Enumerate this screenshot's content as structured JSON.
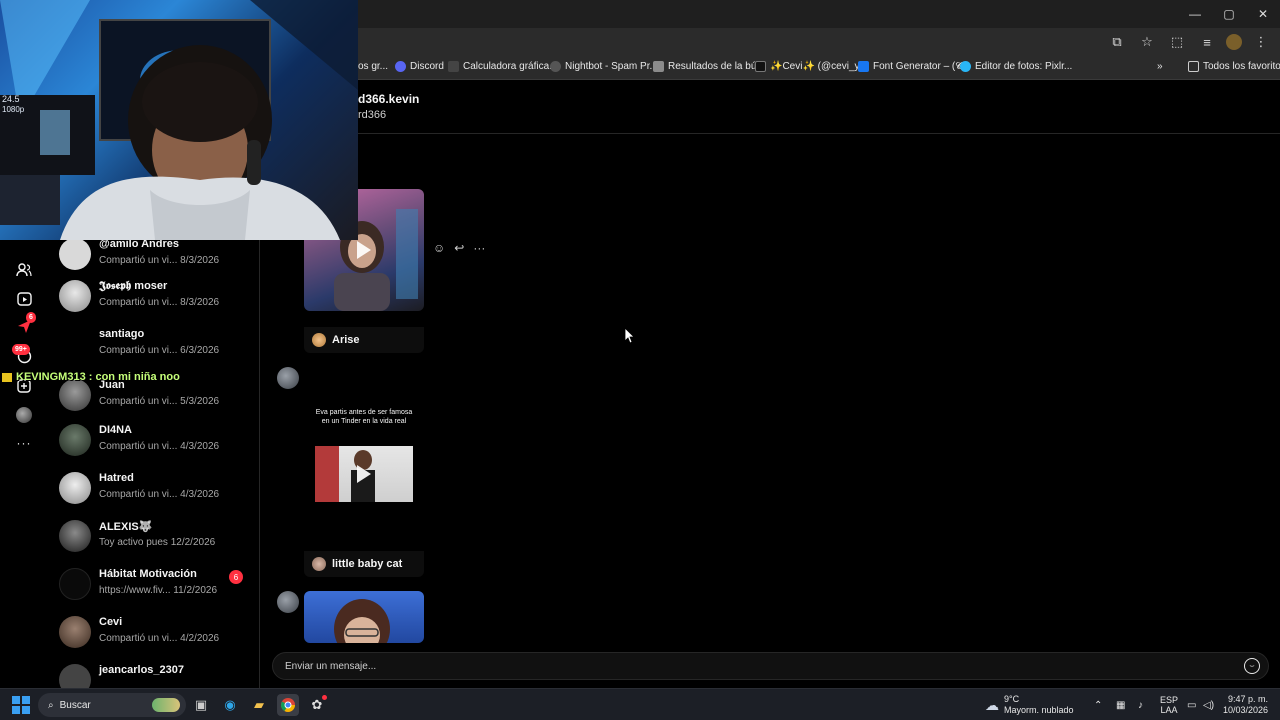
{
  "browser": {
    "window_controls": [
      "—",
      "▢",
      "✕"
    ],
    "toolbar_icons": [
      "cast-icon",
      "star-icon",
      "extensions-icon",
      "media-icon",
      "profile-icon",
      "menu-icon"
    ],
    "bookmarks": [
      {
        "label": "os gr...",
        "icon": "bookmark-icon",
        "color": "#3b3b3b"
      },
      {
        "label": "Discord",
        "icon": "discord-icon",
        "color": "#5865f2"
      },
      {
        "label": "Calculadora gráfica...",
        "icon": "desmos-icon",
        "color": "#444"
      },
      {
        "label": "Nightbot - Spam Pr...",
        "icon": "nightbot-icon",
        "color": "#444"
      },
      {
        "label": "Resultados de la bú...",
        "icon": "doc-icon",
        "color": "#8b8b8b"
      },
      {
        "label": "✨Cevi✨ (@cevi_y...",
        "icon": "tiktok-icon",
        "color": "#111"
      },
      {
        "label": "Font Generator – (𝓒...",
        "icon": "font-icon",
        "color": "#1877f2"
      },
      {
        "label": "Editor de fotos: Pixlr...",
        "icon": "pixlr-icon",
        "color": "#29b6f6"
      }
    ],
    "bookmarks_overflow": "»",
    "all_bookmarks": "Todos los favoritos"
  },
  "stream_overlay": {
    "chat_line": "KEVINGM313 : con mi niña noo"
  },
  "rail": {
    "badges": {
      "notifications": "6",
      "messages": "99+"
    }
  },
  "conversations": [
    {
      "name": "@amilo Andres",
      "preview": "Compartió un vi...",
      "date": "8/3/2026",
      "avatar_color": "#d9d9d9"
    },
    {
      "name": "𝕵𝖔𝖘𝖊𝖕𝖍 moser",
      "preview": "Compartió un vi...",
      "date": "8/3/2026",
      "avatar_color": "#cfcfcf"
    },
    {
      "name": "santiago",
      "preview": "Compartió un vi...",
      "date": "6/3/2026",
      "avatar_color": "#000000"
    },
    {
      "name": "Juan",
      "preview": "Compartió un vi...",
      "date": "5/3/2026",
      "avatar_color": "#6b6b6b"
    },
    {
      "name": "DI4NA",
      "preview": "Compartió un vi...",
      "date": "4/3/2026",
      "avatar_color": "#3a4a3a"
    },
    {
      "name": "Hatred",
      "preview": "Compartió un vi...",
      "date": "4/3/2026",
      "avatar_color": "#bdbdbd"
    },
    {
      "name": "ALEXIS🐺",
      "preview": "Toy activo pues",
      "date": "12/2/2026",
      "avatar_color": "#555"
    },
    {
      "name": "Hábitat Motivación",
      "preview": "https://www.fiv...",
      "date": "11/2/2026",
      "avatar_color": "#111",
      "badge": "6"
    },
    {
      "name": "Cevi",
      "preview": "Compartió un vi...",
      "date": "4/2/2026",
      "avatar_color": "#6b5a4a"
    },
    {
      "name": "jeancarlos_2307",
      "preview": "",
      "date": "",
      "avatar_color": "#444"
    }
  ],
  "chat": {
    "title": "d366.kevin",
    "subtitle": "rd366",
    "messages": [
      {
        "label": "Arise"
      },
      {
        "caption": "Eva partis antes de ser famosa en un Tinder en la vida real"
      },
      {
        "label": "little baby cat"
      }
    ],
    "composer_placeholder": "Enviar un mensaje..."
  },
  "taskbar": {
    "search_label": "Buscar",
    "weather_temp": "9°C",
    "weather_desc": "Mayorm. nublado",
    "language_top": "ESP",
    "language_bottom": "LAA",
    "time": "9:47 p. m.",
    "date": "10/03/2026"
  },
  "colors": {
    "accent_badge": "#ff3040",
    "stream_chat": "#c6ff7a"
  }
}
